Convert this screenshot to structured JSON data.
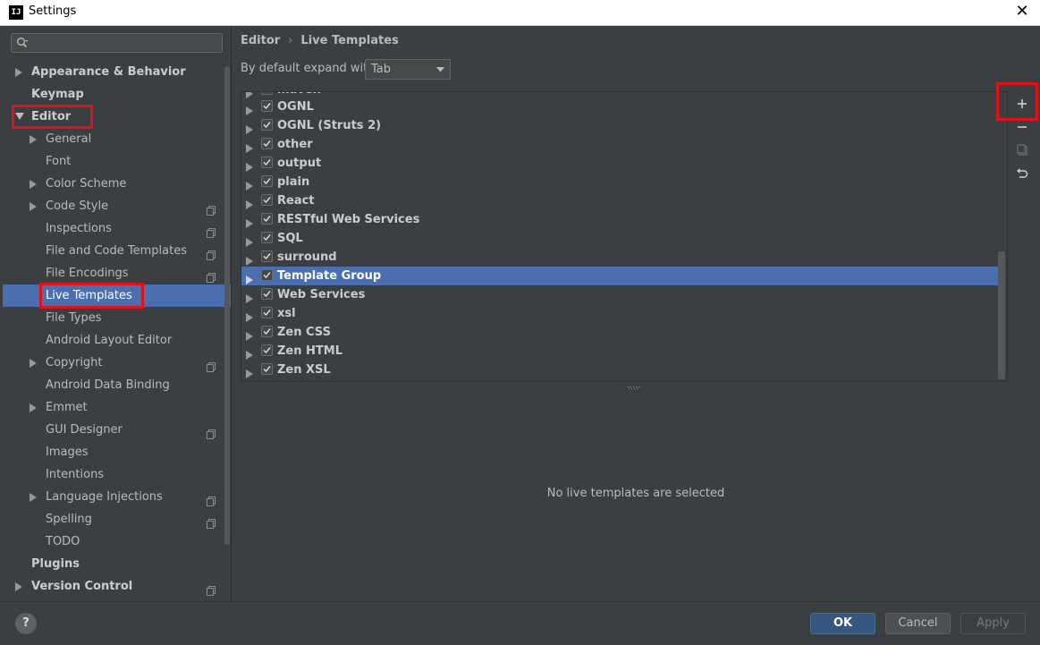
{
  "window": {
    "title": "Settings",
    "icon_text": "IJ"
  },
  "sidebar": {
    "search_placeholder": "",
    "items": [
      {
        "label": "Appearance & Behavior",
        "level": 0,
        "arrow": "collapsed",
        "bold": true,
        "project": false
      },
      {
        "label": "Keymap",
        "level": 0,
        "arrow": "none",
        "bold": true,
        "project": false
      },
      {
        "label": "Editor",
        "level": 0,
        "arrow": "expanded",
        "bold": true,
        "project": false
      },
      {
        "label": "General",
        "level": 1,
        "arrow": "collapsed",
        "bold": false,
        "project": false
      },
      {
        "label": "Font",
        "level": 1,
        "arrow": "none",
        "bold": false,
        "project": false
      },
      {
        "label": "Color Scheme",
        "level": 1,
        "arrow": "collapsed",
        "bold": false,
        "project": false
      },
      {
        "label": "Code Style",
        "level": 1,
        "arrow": "collapsed",
        "bold": false,
        "project": true
      },
      {
        "label": "Inspections",
        "level": 1,
        "arrow": "none",
        "bold": false,
        "project": true
      },
      {
        "label": "File and Code Templates",
        "level": 1,
        "arrow": "none",
        "bold": false,
        "project": true
      },
      {
        "label": "File Encodings",
        "level": 1,
        "arrow": "none",
        "bold": false,
        "project": true
      },
      {
        "label": "Live Templates",
        "level": 1,
        "arrow": "none",
        "bold": false,
        "project": false,
        "selected": true
      },
      {
        "label": "File Types",
        "level": 1,
        "arrow": "none",
        "bold": false,
        "project": false
      },
      {
        "label": "Android Layout Editor",
        "level": 1,
        "arrow": "none",
        "bold": false,
        "project": false
      },
      {
        "label": "Copyright",
        "level": 1,
        "arrow": "collapsed",
        "bold": false,
        "project": true
      },
      {
        "label": "Android Data Binding",
        "level": 1,
        "arrow": "none",
        "bold": false,
        "project": false
      },
      {
        "label": "Emmet",
        "level": 1,
        "arrow": "collapsed",
        "bold": false,
        "project": false
      },
      {
        "label": "GUI Designer",
        "level": 1,
        "arrow": "none",
        "bold": false,
        "project": true
      },
      {
        "label": "Images",
        "level": 1,
        "arrow": "none",
        "bold": false,
        "project": false
      },
      {
        "label": "Intentions",
        "level": 1,
        "arrow": "none",
        "bold": false,
        "project": false
      },
      {
        "label": "Language Injections",
        "level": 1,
        "arrow": "collapsed",
        "bold": false,
        "project": true
      },
      {
        "label": "Spelling",
        "level": 1,
        "arrow": "none",
        "bold": false,
        "project": true
      },
      {
        "label": "TODO",
        "level": 1,
        "arrow": "none",
        "bold": false,
        "project": false
      },
      {
        "label": "Plugins",
        "level": 0,
        "arrow": "none",
        "bold": true,
        "project": false
      },
      {
        "label": "Version Control",
        "level": 0,
        "arrow": "collapsed",
        "bold": true,
        "project": true
      }
    ]
  },
  "content": {
    "breadcrumb": {
      "parent": "Editor",
      "separator": "›",
      "current": "Live Templates"
    },
    "expand_label": "By default expand with",
    "expand_value": "Tab",
    "partial_top_row": "maven",
    "template_groups": [
      {
        "name": "OGNL",
        "checked": true
      },
      {
        "name": "OGNL (Struts 2)",
        "checked": true
      },
      {
        "name": "other",
        "checked": true
      },
      {
        "name": "output",
        "checked": true
      },
      {
        "name": "plain",
        "checked": true
      },
      {
        "name": "React",
        "checked": true
      },
      {
        "name": "RESTful Web Services",
        "checked": true
      },
      {
        "name": "SQL",
        "checked": true
      },
      {
        "name": "surround",
        "checked": true
      },
      {
        "name": "Template Group",
        "checked": true,
        "selected": true
      },
      {
        "name": "Web Services",
        "checked": true
      },
      {
        "name": "xsl",
        "checked": true
      },
      {
        "name": "Zen CSS",
        "checked": true
      },
      {
        "name": "Zen HTML",
        "checked": true
      },
      {
        "name": "Zen XSL",
        "checked": true
      }
    ],
    "tools": [
      "add-icon",
      "remove-icon",
      "copy-icon",
      "revert-icon"
    ],
    "empty_message": "No live templates are selected"
  },
  "footer": {
    "help": "?",
    "ok": "OK",
    "cancel": "Cancel",
    "apply": "Apply"
  },
  "colors": {
    "background": "#3c3f41",
    "selection": "#4b6eaf",
    "highlight_box": "#e0101c",
    "primary_button": "#365880"
  }
}
